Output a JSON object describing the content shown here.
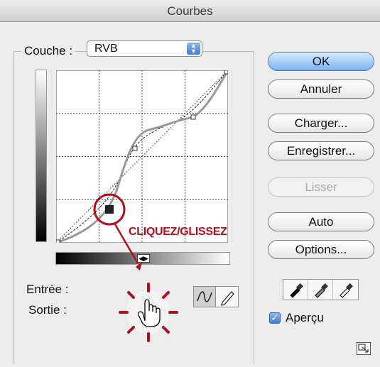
{
  "window": {
    "title": "Courbes"
  },
  "channel": {
    "label": "Couche :",
    "value": "RVB"
  },
  "buttons": {
    "ok": "OK",
    "cancel": "Annuler",
    "load": "Charger...",
    "save": "Enregistrer...",
    "smooth": "Lisser",
    "auto": "Auto",
    "options": "Options..."
  },
  "fields": {
    "input_label": "Entrée :",
    "output_label": "Sortie :"
  },
  "preview": {
    "label": "Aperçu",
    "checked": true
  },
  "annotation": {
    "text": "CLIQUEZ/GLISSEZ",
    "color": "#b0101c"
  },
  "colors": {
    "accent": "#4d7fc2",
    "annotation_red": "#b0101c"
  },
  "icons": [
    "curve-tool-icon",
    "pencil-tool-icon",
    "black-point-eyedropper-icon",
    "gray-point-eyedropper-icon",
    "white-point-eyedropper-icon",
    "expand-view-icon",
    "hand-cursor-icon"
  ]
}
